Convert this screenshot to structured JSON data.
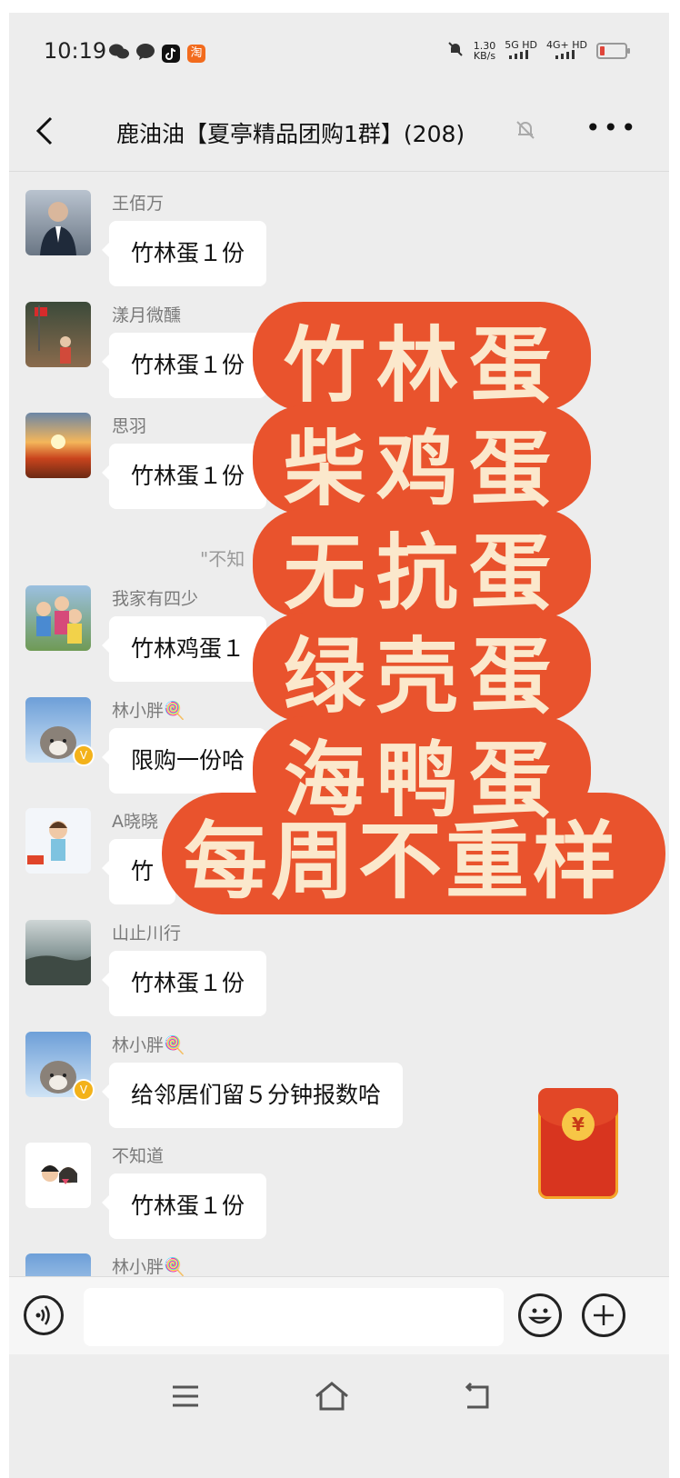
{
  "status_bar": {
    "time": "10:19",
    "net_speed": "1.30",
    "net_unit": "KB/s",
    "sim1": "5G HD",
    "sim2": "4G+ HD",
    "app_icons": [
      "wechat-icon",
      "chat-bubble-icon",
      "tiktok-icon",
      "taobao-icon"
    ],
    "taobao_text": "淘"
  },
  "header": {
    "title": "鹿油油【夏亭精品团购1群】(208)"
  },
  "messages": [
    {
      "name": "王佰万",
      "text": "竹林蛋１份"
    },
    {
      "name": "漾月微醺",
      "text": "竹林蛋１份"
    },
    {
      "name": "思羽",
      "text": "竹林蛋１份"
    },
    {
      "name": "我家有四少",
      "text": "竹林鸡蛋１"
    },
    {
      "name": "林小胖🍭",
      "text": "限购一份哈"
    },
    {
      "name": "A晓晓",
      "text": "竹"
    },
    {
      "name": "山止川行",
      "text": "竹林蛋１份"
    },
    {
      "name": "林小胖🍭",
      "text": "给邻居们留５分钟报数哈"
    },
    {
      "name": "不知道",
      "text": "竹林蛋１份"
    },
    {
      "name": "林小胖🍭",
      "text": ""
    }
  ],
  "system_note": "\"不知",
  "promo": {
    "lines": [
      "竹林蛋",
      "柴鸡蛋",
      "无抗蛋",
      "绿壳蛋",
      "海鸭蛋",
      "每周不重样"
    ],
    "bg_color": "#e9532d",
    "text_color": "#fbe8cc"
  },
  "red_packet": {
    "symbol": "¥"
  },
  "input": {
    "placeholder": ""
  },
  "colors": {
    "chat_bg": "#ededed",
    "bubble": "#ffffff",
    "name": "#7a7a7a"
  }
}
